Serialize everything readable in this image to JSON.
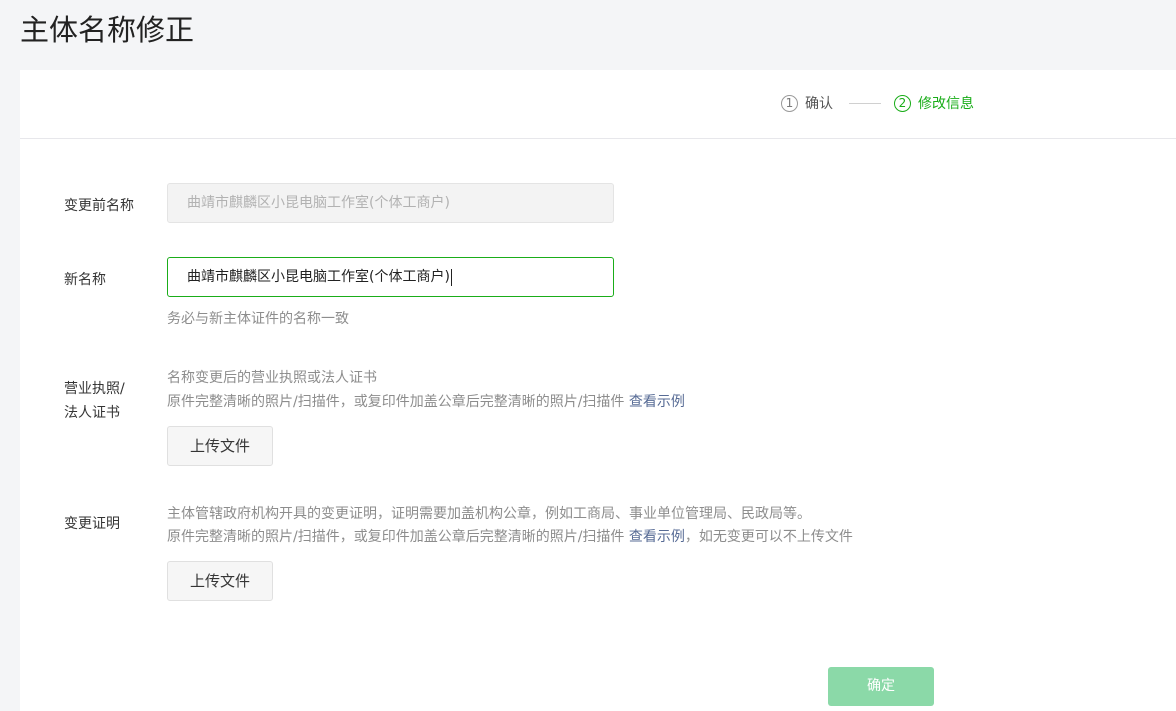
{
  "page": {
    "title": "主体名称修正"
  },
  "steps": [
    {
      "number": "1",
      "label": "确认"
    },
    {
      "number": "2",
      "label": "修改信息"
    }
  ],
  "form": {
    "old_name": {
      "label": "变更前名称",
      "value": "曲靖市麒麟区小昆电脑工作室(个体工商户)"
    },
    "new_name": {
      "label": "新名称",
      "value": "曲靖市麒麟区小昆电脑工作室(个体工商户)",
      "hint": "务必与新主体证件的名称一致"
    },
    "license": {
      "label_line1": "营业执照/",
      "label_line2": "法人证书",
      "desc_line1": "名称变更后的营业执照或法人证书",
      "desc_line2": "原件完整清晰的照片/扫描件，或复印件加盖公章后完整清晰的照片/扫描件",
      "example_link": "查看示例",
      "upload_label": "上传文件"
    },
    "proof": {
      "label": "变更证明",
      "desc_line1": "主体管辖政府机构开具的变更证明，证明需要加盖机构公章，例如工商局、事业单位管理局、民政局等。",
      "desc_line2": "原件完整清晰的照片/扫描件，或复印件加盖公章后完整清晰的照片/扫描件",
      "example_link": "查看示例",
      "desc_suffix": "，如无变更可以不上传文件",
      "upload_label": "上传文件"
    },
    "confirm_label": "确定"
  },
  "colors": {
    "accent": "#1aad19",
    "link": "#576b95",
    "disabled_button": "#8bd9a8"
  }
}
